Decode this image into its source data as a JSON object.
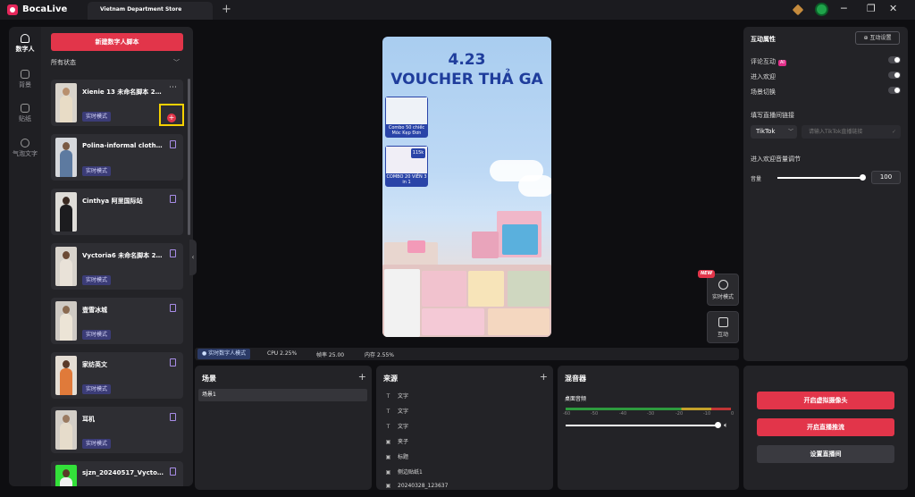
{
  "app": {
    "name": "BocaLive"
  },
  "tabs": [
    {
      "label": "Vietnam Department Store"
    }
  ],
  "left_nav": [
    {
      "label": "数字人"
    },
    {
      "label": "背景"
    },
    {
      "label": "贴纸"
    },
    {
      "label": "气泡文字"
    }
  ],
  "list": {
    "new_button": "新建数字人脚本",
    "filter_value": "所有状态",
    "cards": [
      {
        "title": "Xienie 13 未命名脚本 2…",
        "badge": "实时模式"
      },
      {
        "title": "Polina-informal cloth…",
        "badge": "实时模式"
      },
      {
        "title": "Cinthya 阿里国际站",
        "badge": ""
      },
      {
        "title": "Vyctoria6 未命名脚本 2…",
        "badge": "实时模式"
      },
      {
        "title": "壹雪冰城",
        "badge": "实时模式"
      },
      {
        "title": "家纺英文",
        "badge": "实时模式"
      },
      {
        "title": "耳机",
        "badge": "实时模式"
      },
      {
        "title": "sjzn_20240517_Vycto…",
        "badge": ""
      }
    ]
  },
  "preview": {
    "headline_1": "4.23",
    "headline_2": "VOUCHER THẢ GA",
    "products": [
      {
        "caption": "Combo 50 chiếc Móc Kẹp Đơn"
      },
      {
        "caption": "COMBO 20 VIÊN 3 in 1"
      }
    ],
    "price_tag": "115k"
  },
  "float_buttons": {
    "new_tag": "NEW",
    "realtime": "实时模式",
    "interact": "互动"
  },
  "status_bar": {
    "mode": "实时数字人模式",
    "cpu": "CPU 2.25%",
    "fps": "帧率 25.00",
    "mem": "内存 2.55%"
  },
  "scenes": {
    "title": "场景",
    "items": [
      "场景1"
    ]
  },
  "sources": {
    "title": "来源",
    "items": [
      {
        "label": "文字",
        "icon": "T"
      },
      {
        "label": "文字",
        "icon": "T"
      },
      {
        "label": "文字",
        "icon": "T"
      },
      {
        "label": "夹子",
        "icon": "img"
      },
      {
        "label": "标题",
        "icon": "img"
      },
      {
        "label": "侧边贴纸1",
        "icon": "img"
      },
      {
        "label": "20240328_123637",
        "icon": "img"
      }
    ]
  },
  "mixer": {
    "title": "混音器",
    "channel": "桌面音频",
    "ticks": [
      "-60",
      "-50",
      "-40",
      "-30",
      "-20",
      "-10",
      "0"
    ],
    "level": 0.98
  },
  "interaction": {
    "title": "互动属性",
    "settings_button": "互动设置",
    "toggles": [
      {
        "label": "评论互动",
        "ai": "AI"
      },
      {
        "label": "进入欢迎",
        "ai": ""
      },
      {
        "label": "场景切换",
        "ai": ""
      }
    ],
    "link_label": "填写直播间链接",
    "platform": "TikTok",
    "url_placeholder": "请输入TikTok直播链接",
    "volume_section": "进入欢迎音量调节",
    "volume_label": "音量",
    "volume_value": "100"
  },
  "actions": {
    "camera": "开启虚拟摄像头",
    "stream": "开启直播推流",
    "settings": "设置直播间"
  },
  "colors": {
    "accent": "#e2354a",
    "badge": "#3b3c77",
    "panel": "#232327",
    "highlight": "#f5d100"
  }
}
